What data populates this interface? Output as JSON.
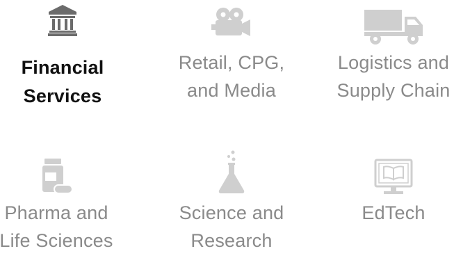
{
  "colors": {
    "active_text": "#111111",
    "inactive_text": "#8a8a8a",
    "active_icon": "#6b6b6b",
    "inactive_icon": "#cfcfcf",
    "background": "#ffffff"
  },
  "industries": [
    {
      "label": "Financial\nServices",
      "icon": "bank-icon",
      "active": true
    },
    {
      "label": "Retail, CPG,\nand Media",
      "icon": "movie-camera-icon",
      "active": false
    },
    {
      "label": "Logistics and\nSupply Chain",
      "icon": "dump-truck-icon",
      "active": false
    },
    {
      "label": "Pharma and\nLife Sciences",
      "icon": "pill-bottle-icon",
      "active": false
    },
    {
      "label": "Science and\nResearch",
      "icon": "flask-icon",
      "active": false
    },
    {
      "label": "EdTech",
      "icon": "monitor-book-icon",
      "active": false
    }
  ]
}
